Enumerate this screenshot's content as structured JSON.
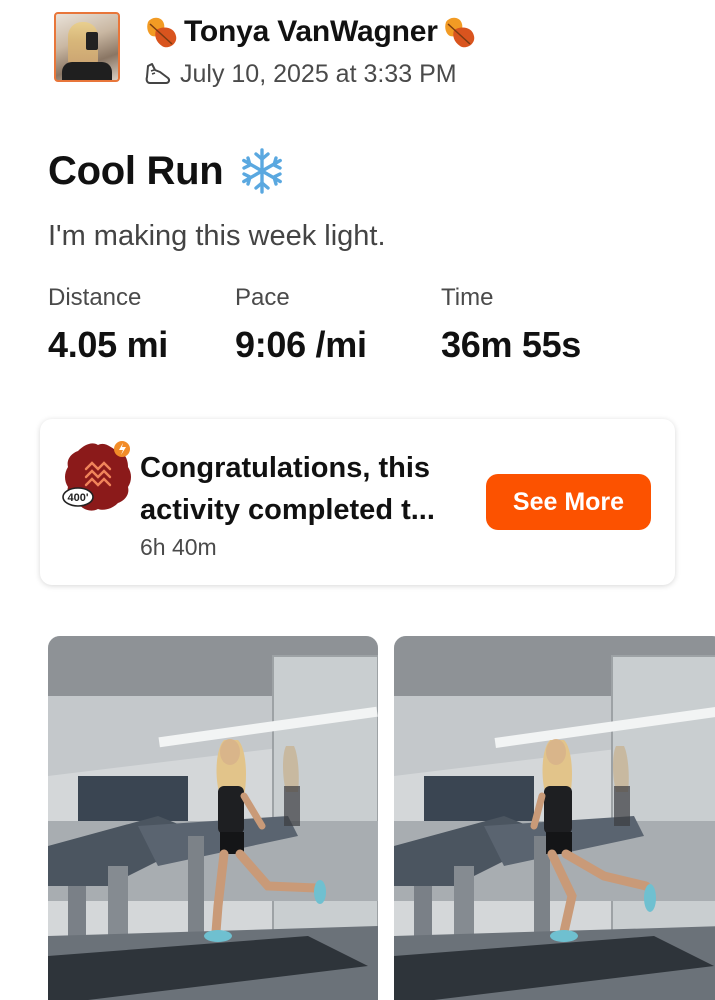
{
  "header": {
    "athlete_name": "Tonya VanWagner",
    "date": "July 10, 2025 at 3:33 PM",
    "icons": {
      "name_decoration": "autumn-leaf-icon",
      "activity_type": "run-shoe-icon"
    }
  },
  "activity": {
    "title": "Cool Run",
    "title_icon": "snowflake-icon",
    "description": "I'm making this week light."
  },
  "stats": [
    {
      "label": "Distance",
      "value": "4.05 mi"
    },
    {
      "label": "Pace",
      "value": "9:06 /mi"
    },
    {
      "label": "Time",
      "value": "36m 55s"
    }
  ],
  "achievement_card": {
    "badge_text": "400'",
    "message": "Congratulations, this activity completed t...",
    "time_ago": "6h 40m",
    "button_label": "See More"
  },
  "photos": [
    "treadmill-run-photo",
    "treadmill-run-photo"
  ],
  "colors": {
    "accent": "#fc5200",
    "badge_red": "#8b1a1a",
    "text": "#111111",
    "muted": "#4a4a4a"
  }
}
